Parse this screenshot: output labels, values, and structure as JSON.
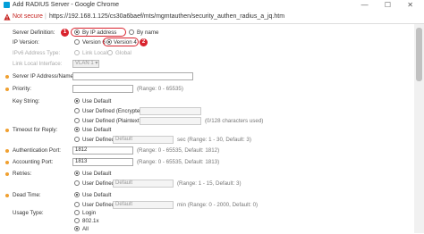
{
  "window": {
    "title": "Add RADIUS Server - Google Chrome",
    "controls": "— ☐ ✕"
  },
  "address_bar": {
    "security": "Not secure",
    "url": "https://192.168.1.125/cs30a6baef/mts/mgmtauthen/security_authen_radius_a_jq.htm"
  },
  "server_definition": {
    "label": "Server Definition:",
    "options": [
      "By IP address",
      "By name"
    ],
    "selected": "By IP address",
    "badge": "1"
  },
  "ip_version": {
    "label": "IP Version:",
    "options": [
      "Version 6",
      "Version 4"
    ],
    "selected": "Version 4",
    "badge": "2"
  },
  "ipv6_address_type": {
    "label": "IPv6 Address Type:",
    "options": [
      "Link Local",
      "Global"
    ]
  },
  "link_local_interface": {
    "label": "Link Local Interface:",
    "value": "VLAN 1"
  },
  "server_ip": {
    "label": "Server IP Address/Name:",
    "value": ""
  },
  "priority": {
    "label": "Priority:",
    "value": "",
    "hint": "(Range: 0 - 65535)"
  },
  "key_string": {
    "label": "Key String:",
    "options": [
      "Use Default",
      "User Defined (Encrypted)",
      "User Defined (Plaintext)"
    ],
    "hint": "(0/128 characters used)"
  },
  "timeout": {
    "label": "Timeout for Reply:",
    "options": [
      "Use Default",
      "User Defined"
    ],
    "placeholder": "Default",
    "hint": "sec (Range: 1 - 30, Default: 3)"
  },
  "auth_port": {
    "label": "Authentication Port:",
    "value": "1812",
    "hint": "(Range: 0 - 65535, Default: 1812)"
  },
  "acct_port": {
    "label": "Accounting Port:",
    "value": "1813",
    "hint": "(Range: 0 - 65535, Default: 1813)"
  },
  "retries": {
    "label": "Retries:",
    "options": [
      "Use Default",
      "User Defined"
    ],
    "placeholder": "Default",
    "hint": "(Range: 1 - 15, Default: 3)"
  },
  "dead_time": {
    "label": "Dead Time:",
    "options": [
      "Use Default",
      "User Defined"
    ],
    "placeholder": "Default",
    "hint": "min (Range: 0 - 2000, Default: 0)"
  },
  "usage_type": {
    "label": "Usage Type:",
    "options": [
      "Login",
      "802.1x",
      "All"
    ],
    "selected": "All"
  },
  "colors": {
    "accent": "#d9232e",
    "required_dot": "#f0a030"
  }
}
